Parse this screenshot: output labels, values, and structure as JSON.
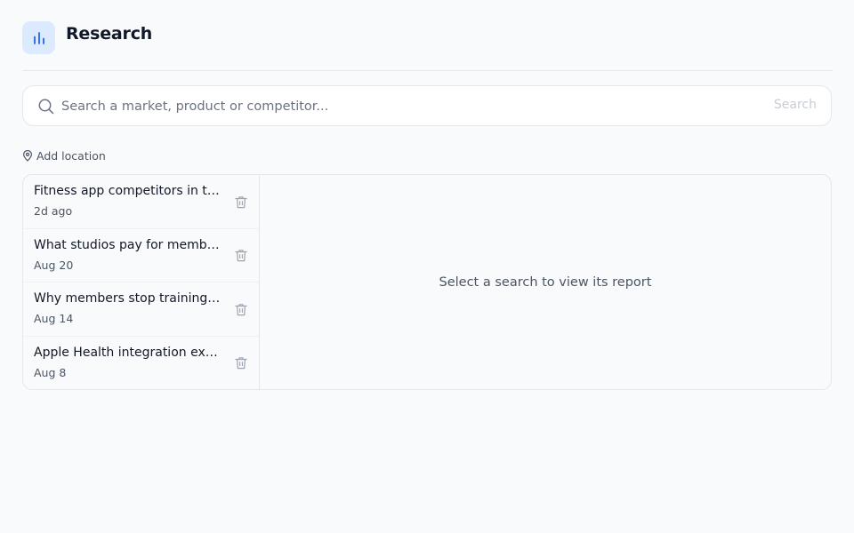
{
  "header": {
    "title": "Research",
    "icon": "bar-chart-icon",
    "accent": "#2563eb"
  },
  "search": {
    "placeholder": "Search a market, product or competitor...",
    "value": "",
    "button_label": "Search"
  },
  "location": {
    "label": "Add location",
    "icon": "map-pin-icon"
  },
  "history": {
    "items": [
      {
        "title": "Fitness app competitors in the UK",
        "date": "2d ago"
      },
      {
        "title": "What studios pay for membership software",
        "date": "Aug 20"
      },
      {
        "title": "Why members stop training at studios",
        "date": "Aug 14"
      },
      {
        "title": "Apple Health integration expectations",
        "date": "Aug 8"
      }
    ],
    "delete_icon": "trash-icon"
  },
  "report": {
    "empty_text": "Select a search to view its report"
  }
}
